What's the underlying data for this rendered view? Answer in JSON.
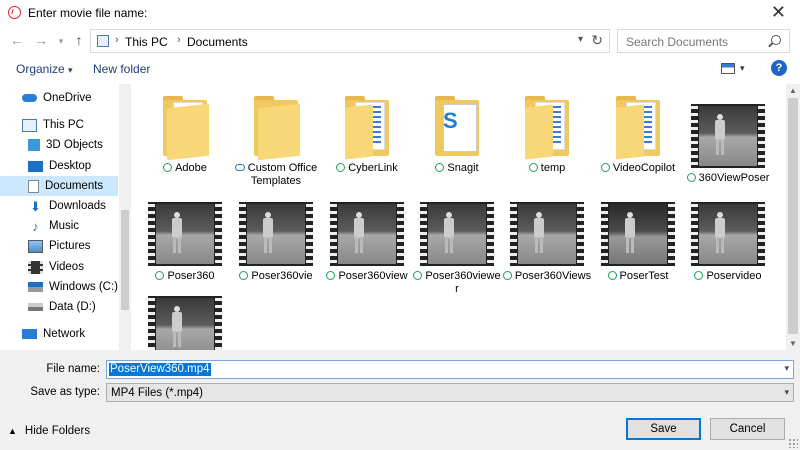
{
  "window": {
    "title": "Enter movie file name:"
  },
  "address": {
    "crumbs": [
      "This PC",
      "Documents"
    ]
  },
  "search": {
    "placeholder": "Search Documents"
  },
  "toolbar": {
    "organize": "Organize",
    "new_folder": "New folder"
  },
  "nav": {
    "items": [
      {
        "label": "OneDrive",
        "icon": "cloud-icon"
      },
      {
        "label": "This PC",
        "icon": "computer-icon"
      },
      {
        "label": "3D Objects",
        "icon": "cube-icon"
      },
      {
        "label": "Desktop",
        "icon": "desktop-icon"
      },
      {
        "label": "Documents",
        "icon": "documents-icon",
        "selected": true
      },
      {
        "label": "Downloads",
        "icon": "download-icon"
      },
      {
        "label": "Music",
        "icon": "music-icon"
      },
      {
        "label": "Pictures",
        "icon": "pictures-icon"
      },
      {
        "label": "Videos",
        "icon": "videos-icon"
      },
      {
        "label": "Windows (C:)",
        "icon": "drive-icon"
      },
      {
        "label": "Data (D:)",
        "icon": "drive-icon"
      },
      {
        "label": "Network",
        "icon": "network-icon"
      }
    ]
  },
  "files": [
    {
      "name": "Adobe",
      "kind": "folder"
    },
    {
      "name": "Custom Office Templates",
      "kind": "folder",
      "status": "cloud"
    },
    {
      "name": "CyberLink",
      "kind": "folder"
    },
    {
      "name": "Snagit",
      "kind": "folder"
    },
    {
      "name": "temp",
      "kind": "folder"
    },
    {
      "name": "VideoCopilot",
      "kind": "folder"
    },
    {
      "name": "360ViewPoser",
      "kind": "video"
    },
    {
      "name": "Poser360",
      "kind": "video"
    },
    {
      "name": "Poser360vie",
      "kind": "video"
    },
    {
      "name": "Poser360view",
      "kind": "video"
    },
    {
      "name": "Poser360viewer",
      "kind": "video"
    },
    {
      "name": "Poser360Views",
      "kind": "video"
    },
    {
      "name": "PoserTest",
      "kind": "video"
    },
    {
      "name": "Poservideo",
      "kind": "video"
    },
    {
      "name": "",
      "kind": "video"
    }
  ],
  "form": {
    "file_name_label": "File name:",
    "file_name_value": "PoserView360.mp4",
    "save_as_type_label": "Save as type:",
    "save_as_type_value": "MP4 Files (*.mp4)"
  },
  "footer": {
    "hide_folders": "Hide Folders",
    "save": "Save",
    "cancel": "Cancel"
  },
  "colors": {
    "accent": "#0078d7",
    "folder": "#f0c860",
    "selected": "#cce8ff"
  }
}
